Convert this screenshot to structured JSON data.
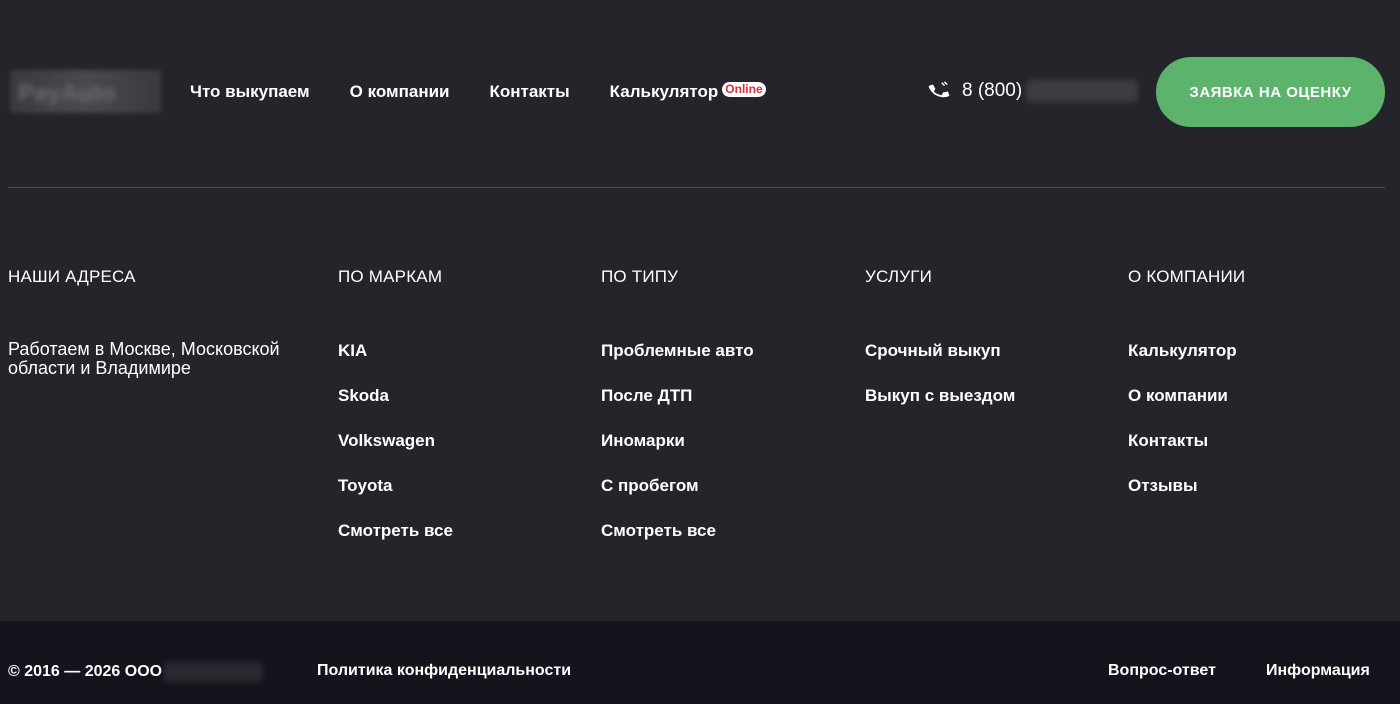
{
  "header": {
    "logo_text": "PayAuto",
    "nav": [
      {
        "label": "Что выкупаем"
      },
      {
        "label": "О компании"
      },
      {
        "label": "Контакты"
      },
      {
        "label": "Калькулятор",
        "badge": "Online"
      }
    ],
    "phone": "8 (800)",
    "cta_label": "ЗАЯВКА НА ОЦЕНКУ",
    "cta_color": "#5cb36c"
  },
  "footer": {
    "addresses": {
      "title": "НАШИ АДРЕСА",
      "text": "Работаем в Москве, Московской области и Владимире"
    },
    "brands": {
      "title": "ПО МАРКАМ",
      "items": [
        "KIA",
        "Skoda",
        "Volkswagen",
        "Toyota",
        "Смотреть все"
      ]
    },
    "types": {
      "title": "ПО ТИПУ",
      "items": [
        "Проблемные авто",
        "После ДТП",
        "Иномарки",
        "С пробегом",
        "Смотреть все"
      ]
    },
    "services": {
      "title": "УСЛУГИ",
      "items": [
        "Срочный выкуп",
        "Выкуп с выездом"
      ]
    },
    "company": {
      "title": "О КОМПАНИИ",
      "items": [
        "Калькулятор",
        "О компании",
        "Контакты",
        "Отзывы"
      ]
    }
  },
  "bottom": {
    "copyright": "© 2016 — 2026 ООО",
    "policy": "Политика конфиденциальности",
    "faq": "Вопрос-ответ",
    "info": "Информация"
  },
  "colors": {
    "background": "#26242b",
    "bottom_bar": "#15141c",
    "badge_text": "#d3313c"
  }
}
